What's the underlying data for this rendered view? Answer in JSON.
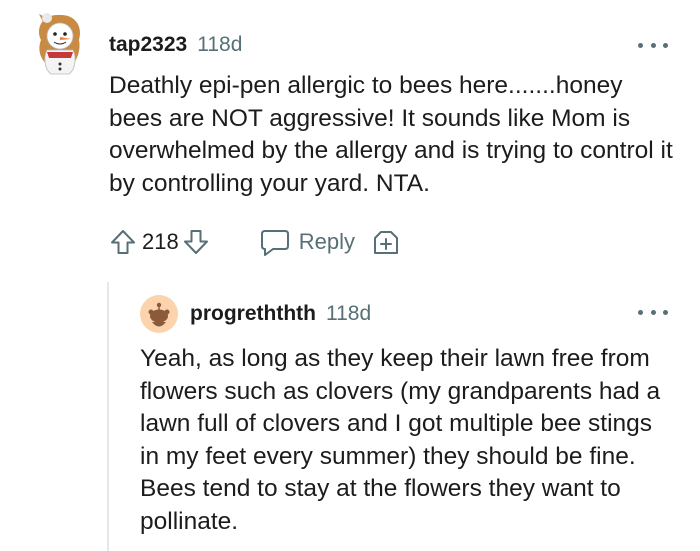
{
  "comment": {
    "username": "tap2323",
    "age": "118d",
    "body": "Deathly epi-pen allergic to bees here.......honey bees are NOT aggressive! It sounds like Mom is overwhelmed by the allergy and is trying to control it by controlling your yard. NTA.",
    "score": "218",
    "reply_label": "Reply",
    "icons": [
      "snowman-avatar-icon",
      "upvote-arrow-icon",
      "downvote-arrow-icon",
      "speech-bubble-icon",
      "award-plus-icon",
      "more-options-icon"
    ]
  },
  "reply": {
    "username": "progreththth",
    "age": "118d",
    "body": "Yeah, as long as they keep their lawn free from flowers such as clovers (my grandparents had a lawn full of clovers and I got multiple bee stings in my feet every summer) they should be fine. Bees tend to stay at the flowers they want to pollinate.",
    "icons": [
      "snoo-avatar-icon",
      "more-options-icon"
    ]
  },
  "colors": {
    "text": "#1c1c1c",
    "meta": "#576f76",
    "thread_line": "#e4e8ea",
    "reply_avatar_bg": "#fcd3ac"
  }
}
